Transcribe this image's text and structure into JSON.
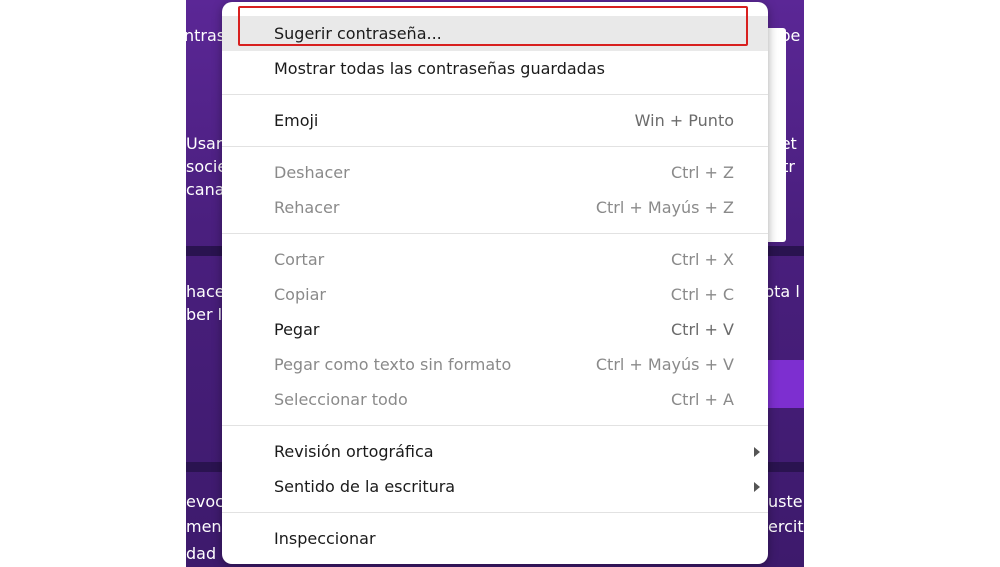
{
  "background": {
    "fragments_left": [
      "ntrase",
      "Usar c",
      "socie",
      "cana",
      "hace",
      "ber le",
      "evoca",
      "ment",
      "dad"
    ],
    "fragments_right": [
      "spe",
      "ket",
      "ntr",
      "pta l",
      "uste",
      "ercit"
    ]
  },
  "menu": {
    "items": [
      {
        "label": "Sugerir contraseña...",
        "shortcut": "",
        "state": "highlighted"
      },
      {
        "label": "Mostrar todas las contraseñas guardadas",
        "shortcut": ""
      },
      {
        "label": "Emoji",
        "shortcut": "Win + Punto"
      },
      {
        "label": "Deshacer",
        "shortcut": "Ctrl + Z",
        "state": "disabled"
      },
      {
        "label": "Rehacer",
        "shortcut": "Ctrl + Mayús + Z",
        "state": "disabled"
      },
      {
        "label": "Cortar",
        "shortcut": "Ctrl + X",
        "state": "disabled"
      },
      {
        "label": "Copiar",
        "shortcut": "Ctrl + C",
        "state": "disabled"
      },
      {
        "label": "Pegar",
        "shortcut": "Ctrl + V"
      },
      {
        "label": "Pegar como texto sin formato",
        "shortcut": "Ctrl + Mayús + V",
        "state": "disabled"
      },
      {
        "label": "Seleccionar todo",
        "shortcut": "Ctrl + A",
        "state": "disabled"
      },
      {
        "label": "Revisión ortográfica",
        "shortcut": "",
        "submenu": true
      },
      {
        "label": "Sentido de la escritura",
        "shortcut": "",
        "submenu": true
      },
      {
        "label": "Inspeccionar",
        "shortcut": ""
      }
    ]
  },
  "colors": {
    "highlight_border": "#d8201f",
    "background_purple": "#4a1f7e",
    "accent_purple": "#7d2fd0"
  }
}
